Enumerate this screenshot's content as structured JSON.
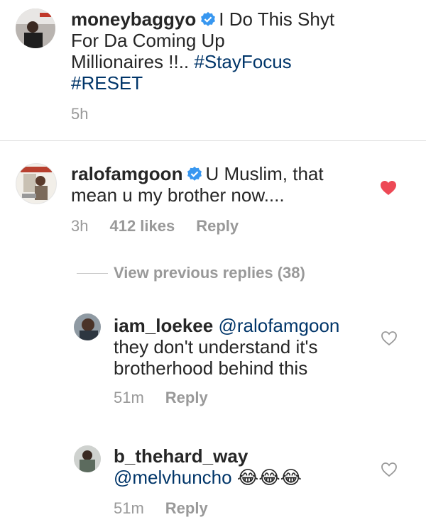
{
  "post": {
    "username": "moneybaggyo",
    "caption_line1": "I Do This Shyt",
    "caption_line2": "For Da Coming Up",
    "caption_line3": "Millionaires !!..",
    "hashtag1": "#StayFocus",
    "hashtag2": "#RESET",
    "time": "5h"
  },
  "comment": {
    "username": "ralofamgoon",
    "text_line1": "U Muslim, that",
    "text_line2": "mean u my brother now....",
    "time": "3h",
    "likes": "412 likes",
    "reply_label": "Reply",
    "liked": true,
    "heart_color": "#ed4956"
  },
  "view_previous": "View previous replies (38)",
  "replies": [
    {
      "username": "iam_loekee",
      "mention": "@ralofamgoon",
      "text_line1": "they don't understand it's",
      "text_line2": "brotherhood behind this",
      "time": "51m",
      "reply_label": "Reply",
      "icon": "heart-outline-icon"
    },
    {
      "username": "b_thehard_way",
      "mention": "@melvhuncho",
      "emojis": "😂😂😂",
      "time": "51m",
      "reply_label": "Reply",
      "icon": "heart-outline-icon"
    }
  ],
  "colors": {
    "text": "#262626",
    "link": "#003569",
    "meta": "#999999",
    "verified": "#3897f0"
  }
}
